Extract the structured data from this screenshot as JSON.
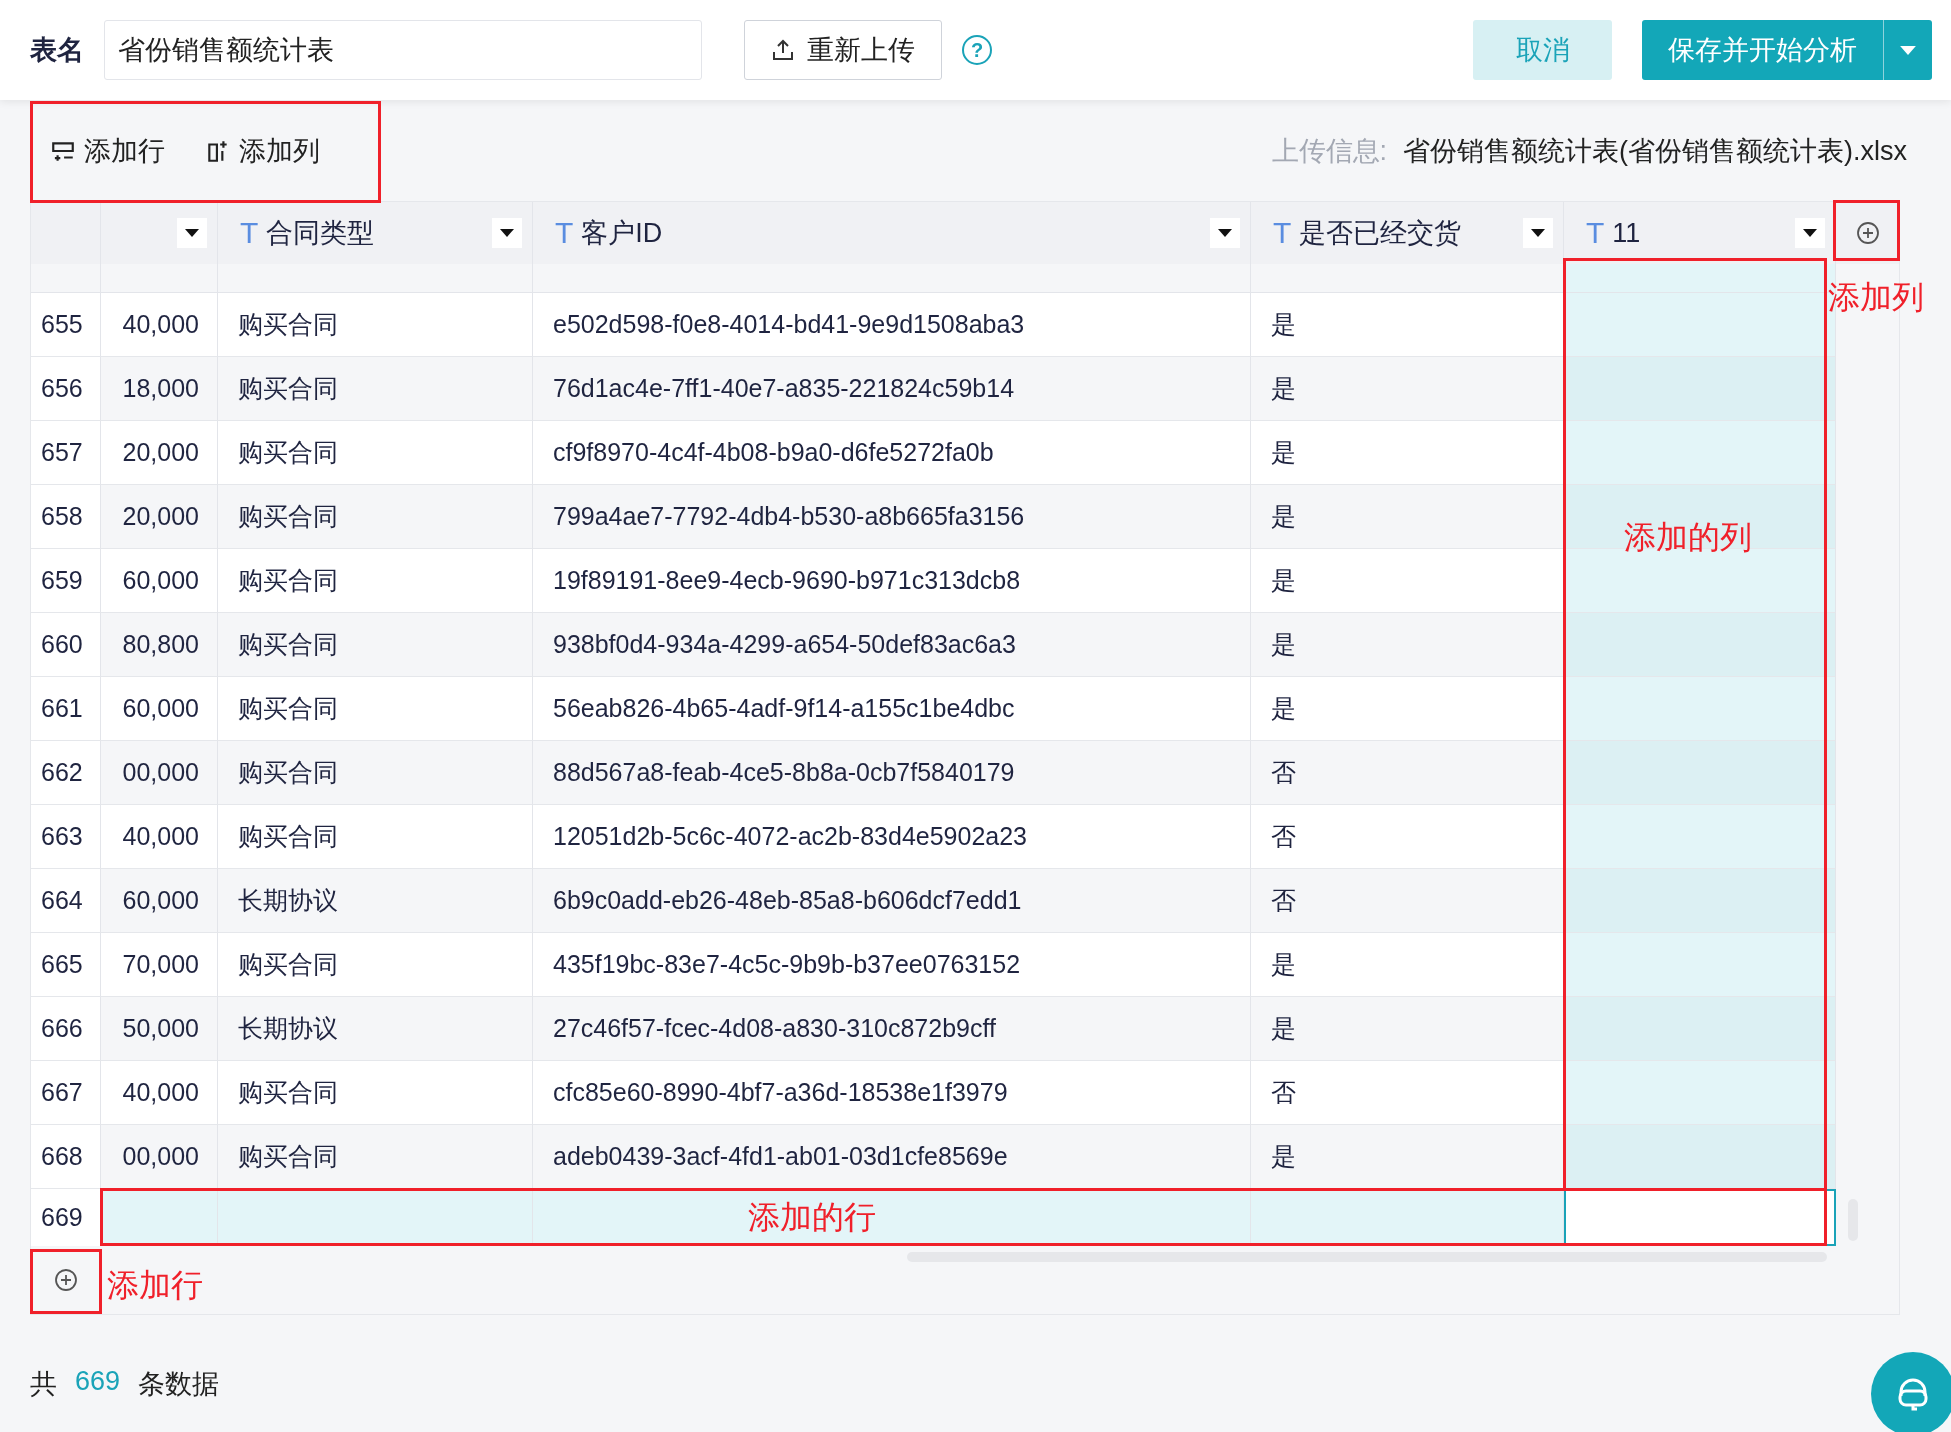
{
  "header": {
    "table_name_label": "表名",
    "table_name_value": "省份销售额统计表",
    "reupload_button": "重新上传",
    "help_icon": "?",
    "cancel_button": "取消",
    "save_button": "保存并开始分析"
  },
  "toolbar": {
    "add_row_button": "添加行",
    "add_column_button": "添加列",
    "upload_info_label": "上传信息:",
    "upload_info_value": "省份销售额统计表(省份销售额统计表).xlsx"
  },
  "columns": [
    {
      "kind": "cut",
      "new": false
    },
    {
      "kind": "text",
      "type_icon": "T",
      "name": "合同类型",
      "new": false
    },
    {
      "kind": "text",
      "type_icon": "T",
      "name": "客户ID",
      "new": false
    },
    {
      "kind": "text",
      "type_icon": "T",
      "name": "是否已经交货",
      "new": false
    },
    {
      "kind": "text",
      "type_icon": "T",
      "name": "11",
      "new": true
    }
  ],
  "rows": [
    {
      "index": "655",
      "cells": [
        "40,000",
        "购买合同",
        "e502d598-f0e8-4014-bd41-9e9d1508aba3",
        "是"
      ],
      "new": false
    },
    {
      "index": "656",
      "cells": [
        "18,000",
        "购买合同",
        "76d1ac4e-7ff1-40e7-a835-221824c59b14",
        "是"
      ],
      "new": false
    },
    {
      "index": "657",
      "cells": [
        "20,000",
        "购买合同",
        "cf9f8970-4c4f-4b08-b9a0-d6fe5272fa0b",
        "是"
      ],
      "new": false
    },
    {
      "index": "658",
      "cells": [
        "20,000",
        "购买合同",
        "799a4ae7-7792-4db4-b530-a8b665fa3156",
        "是"
      ],
      "new": false
    },
    {
      "index": "659",
      "cells": [
        "60,000",
        "购买合同",
        "19f89191-8ee9-4ecb-9690-b971c313dcb8",
        "是"
      ],
      "new": false
    },
    {
      "index": "660",
      "cells": [
        "80,800",
        "购买合同",
        "938bf0d4-934a-4299-a654-50def83ac6a3",
        "是"
      ],
      "new": false
    },
    {
      "index": "661",
      "cells": [
        "60,000",
        "购买合同",
        "56eab826-4b65-4adf-9f14-a155c1be4dbc",
        "是"
      ],
      "new": false
    },
    {
      "index": "662",
      "cells": [
        "00,000",
        "购买合同",
        "88d567a8-feab-4ce5-8b8a-0cb7f5840179",
        "否"
      ],
      "new": false
    },
    {
      "index": "663",
      "cells": [
        "40,000",
        "购买合同",
        "12051d2b-5c6c-4072-ac2b-83d4e5902a23",
        "否"
      ],
      "new": false
    },
    {
      "index": "664",
      "cells": [
        "60,000",
        "长期协议",
        "6b9c0add-eb26-48eb-85a8-b606dcf7edd1",
        "否"
      ],
      "new": false
    },
    {
      "index": "665",
      "cells": [
        "70,000",
        "购买合同",
        "435f19bc-83e7-4c5c-9b9b-b37ee0763152",
        "是"
      ],
      "new": false
    },
    {
      "index": "666",
      "cells": [
        "50,000",
        "长期协议",
        "27c46f57-fcec-4d08-a830-310c872b9cff",
        "是"
      ],
      "new": false
    },
    {
      "index": "667",
      "cells": [
        "40,000",
        "购买合同",
        "cfc85e60-8990-4bf7-a36d-18538e1f3979",
        "否"
      ],
      "new": false
    },
    {
      "index": "668",
      "cells": [
        "00,000",
        "购买合同",
        "adeb0439-3acf-4fd1-ab01-03d1cfe8569e",
        "是"
      ],
      "new": false
    },
    {
      "index": "669",
      "new": true
    }
  ],
  "annotations": {
    "add_column_label": "添加列",
    "added_column_label": "添加的列",
    "added_row_label": "添加的行",
    "add_row_label": "添加行"
  },
  "footer": {
    "prefix": "共",
    "count": "669",
    "suffix": "条数据"
  }
}
